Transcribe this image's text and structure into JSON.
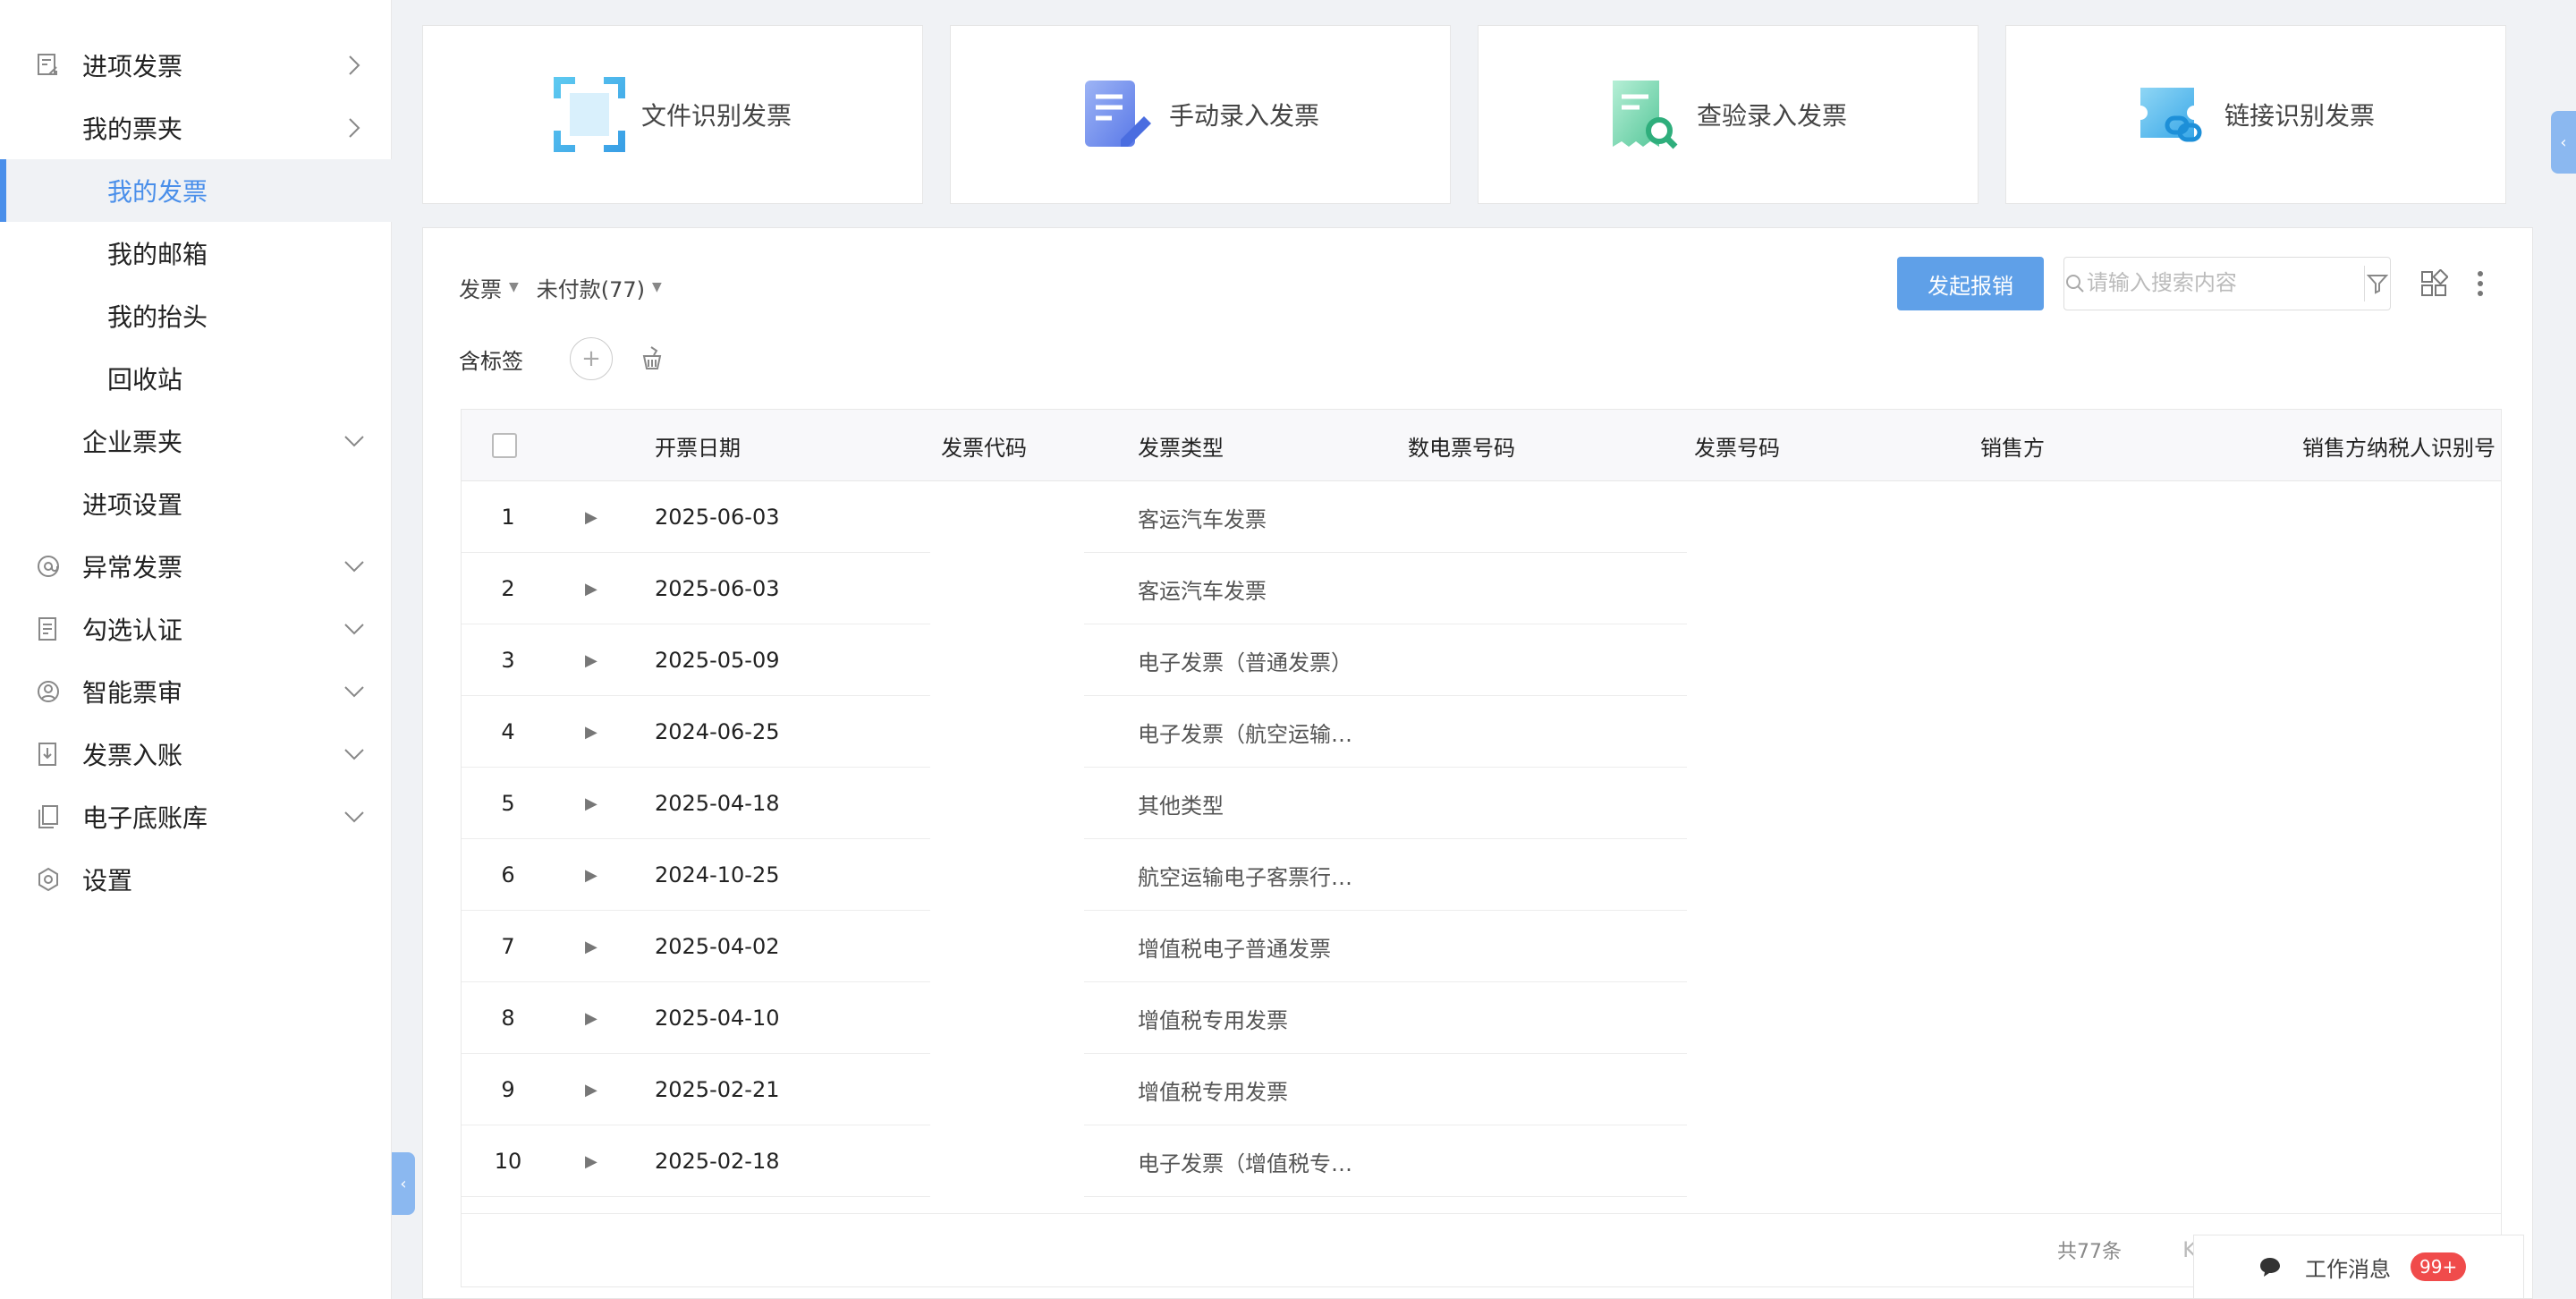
{
  "sidebar": {
    "items": [
      {
        "label": "进项发票",
        "icon": "invoice-in-icon",
        "arrow": "chevron-right-icon"
      },
      {
        "label": "我的票夹",
        "arrow": "chevron-right-icon"
      },
      {
        "label": "我的发票",
        "active": true
      },
      {
        "label": "我的邮箱"
      },
      {
        "label": "我的抬头"
      },
      {
        "label": "回收站"
      },
      {
        "label": "企业票夹",
        "arrow": "chevron-down-icon"
      },
      {
        "label": "进项设置"
      },
      {
        "label": "异常发票",
        "icon": "at-sign-icon",
        "arrow": "chevron-down-icon"
      },
      {
        "label": "勾选认证",
        "icon": "checklist-doc-icon",
        "arrow": "chevron-down-icon"
      },
      {
        "label": "智能票审",
        "icon": "user-circle-icon",
        "arrow": "chevron-down-icon"
      },
      {
        "label": "发票入账",
        "icon": "download-doc-icon",
        "arrow": "chevron-down-icon"
      },
      {
        "label": "电子底账库",
        "icon": "copy-doc-icon",
        "arrow": "chevron-down-icon"
      },
      {
        "label": "设置",
        "icon": "hexagon-gear-icon"
      }
    ]
  },
  "cards": [
    {
      "label": "文件识别发票",
      "icon": "scan-frame-icon"
    },
    {
      "label": "手动录入发票",
      "icon": "edit-doc-icon"
    },
    {
      "label": "查验录入发票",
      "icon": "search-doc-icon"
    },
    {
      "label": "链接识别发票",
      "icon": "link-ticket-icon"
    }
  ],
  "toolbar": {
    "filter_type": "发票",
    "filter_status": "未付款(77)",
    "tag_label": "含标签",
    "submit_button": "发起报销",
    "search_placeholder": "请输入搜索内容"
  },
  "table": {
    "columns": [
      "开票日期",
      "发票代码",
      "发票类型",
      "数电票号码",
      "发票号码",
      "销售方",
      "销售方纳税人识别号"
    ],
    "rows": [
      {
        "index": "1",
        "date": "2025-06-03",
        "type": "客运汽车发票"
      },
      {
        "index": "2",
        "date": "2025-06-03",
        "type": "客运汽车发票"
      },
      {
        "index": "3",
        "date": "2025-05-09",
        "type": "电子发票（普通发票）"
      },
      {
        "index": "4",
        "date": "2024-06-25",
        "type": "电子发票（航空运输…"
      },
      {
        "index": "5",
        "date": "2025-04-18",
        "type": "其他类型"
      },
      {
        "index": "6",
        "date": "2024-10-25",
        "type": "航空运输电子客票行…"
      },
      {
        "index": "7",
        "date": "2025-04-02",
        "type": "增值税电子普通发票"
      },
      {
        "index": "8",
        "date": "2025-04-10",
        "type": "增值税专用发票"
      },
      {
        "index": "9",
        "date": "2025-02-21",
        "type": "增值税专用发票"
      },
      {
        "index": "10",
        "date": "2025-02-18",
        "type": "电子发票（增值税专…"
      }
    ],
    "total": "共77条"
  },
  "messages": {
    "label": "工作消息",
    "badge": "99+"
  },
  "colors": {
    "accent": "#4a8fea",
    "button": "#5fa0e8",
    "badge": "#f04b4b"
  }
}
